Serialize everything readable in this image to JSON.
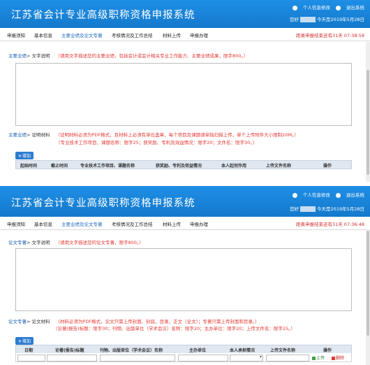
{
  "app": {
    "title": "江苏省会计专业高级职称资格申报系统",
    "link_info": "个人信息修改",
    "link_logout": "退出系统"
  },
  "top": {
    "greeting": "您好",
    "date": "今天是2019年5月28日",
    "countdown": "距离申报结束还有31天 07:38:58",
    "nav": [
      "申报须知",
      "基本信息",
      "主要业绩及论文专著",
      "考核情况及工作总结",
      "材料上传",
      "申报办理"
    ],
    "crumb1_link": "主要业绩",
    "crumb1_sep": "> 文字说明",
    "crumb1_hint": "（请用文字描述您的主要业绩，包括会计或会计相关专业工作能力、主要业绩成果，限字800。）",
    "crumb2_link": "主要业绩",
    "crumb2_sep": "> 证明材料",
    "crumb2_hint": "（证明材料必须为PDF格式，且材料上必须有单位盖章，每个项目及课题请单独扫描上传，单个上传附件大小限制20M。）",
    "crumb2_hint2": "（专业技术工作项目、课题名称：限字25；获奖励、专利及效益情况：限字20；文件名：限字30。）",
    "add_label": "增加",
    "table_headers": [
      "起始时间",
      "截止时间",
      "专业技术工作项目、课题名称",
      "获奖励、专利及效益情况",
      "本人起何作用",
      "上传文件名称",
      "操作"
    ]
  },
  "bottom": {
    "greeting": "您好",
    "date": "今天是2019年5月28日",
    "countdown": "距离申报结束还有31天 07:36:48",
    "nav": [
      "申报须知",
      "基本信息",
      "主要业绩及论文专著",
      "考核情况及工作总结",
      "材料上传",
      "申报办理"
    ],
    "crumb1_link": "论文专著",
    "crumb1_sep": "> 文字说明",
    "crumb1_hint": "（请用文字描述您的论文专著，限字800。）",
    "crumb2_link": "论文专著",
    "crumb2_sep": "> 论文材料",
    "crumb2_hint": "（材料必须为PDF格式，论文只需上传封面、封底、目录、正文（全文）；专著只需上传封面和目录。）",
    "crumb2_hint2": "（论著(报告)标题：限字30；刊物、出版单位（学术会议）名称：限字20；主办单位：限字20；上传文件名：限字25。）",
    "add_label": "增加",
    "table_headers": [
      "日期",
      "论著(报告)标题",
      "刊物、出版单位（学术会议）名称",
      "主办单位",
      "本人承担情况",
      "上传文件名称",
      "操作"
    ],
    "row_upload": "上传",
    "row_delete": "删除"
  }
}
